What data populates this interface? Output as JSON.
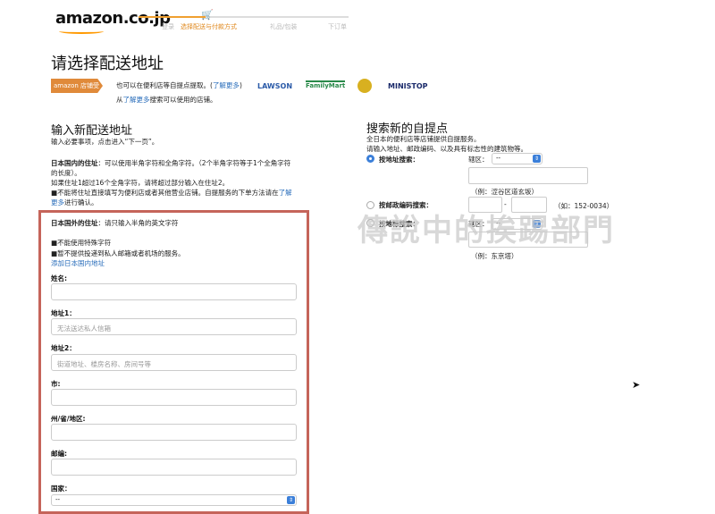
{
  "header": {
    "logo": "amazon.co.jp",
    "steps": [
      "登录",
      "选择配送与付款方式",
      "礼品/包装",
      "下订单"
    ],
    "active_step": 1
  },
  "page_title": "请选择配送地址",
  "pickup_banner": {
    "badge": "amazon 店铺受取",
    "line1": "也可以在便利店等自提点提取。(",
    "line1_link": "了解更多",
    "line1_end": ")",
    "line2_pre": "从",
    "line2_link": "了解更多",
    "line2_post": "搜索可以使用的店铺。",
    "stores": [
      "LAWSON",
      "FamilyMart",
      "ヤマト運輸",
      "MINISTOP"
    ]
  },
  "new_address": {
    "title": "输入新配送地址",
    "subtitle": "输入必要事项，点击进入“下一页”。",
    "domestic_label": "日本国内的住址",
    "domestic_text": "：可以使用半角字符和全角字符。（2个半角字符等于1个全角字符的长度）。",
    "domestic_note1": "如果住址1超过16个全角字符，请将超过部分输入在住址2。",
    "domestic_note2": "■不能将住址直接填写为便利店或者其他营业店铺。自提服务的下单方法请在",
    "domestic_note2_link": "了解更多",
    "domestic_note2_end": "进行确认。",
    "foreign_label": "日本国外的住址",
    "foreign_text": "：请只输入半角的英文字符",
    "foreign_note1": "■不能使用特殊字符",
    "foreign_note2": "■暂不提供投递到私人邮箱或者机场的服务。",
    "add_domestic_link": "添加日本国内地址",
    "fields": [
      {
        "label": "姓名:",
        "placeholder": ""
      },
      {
        "label": "地址1：",
        "placeholder": "无法送达私人信箱"
      },
      {
        "label": "地址2：",
        "placeholder": "街道地址、楼房名称、房间号等"
      },
      {
        "label": "市:",
        "placeholder": ""
      },
      {
        "label": "州/省/地区:",
        "placeholder": ""
      },
      {
        "label": "邮编:",
        "placeholder": ""
      }
    ],
    "country_label": "国家：",
    "country_value": "--"
  },
  "pickup_search": {
    "title": "搜索新的自提点",
    "line1": "全日本的便利店等店铺提供自提服务。",
    "line2": "请输入地址、邮政编码、以及具有标志性的建筑物等。",
    "by_address": "按地址搜索：",
    "district_label": "辖区：",
    "district_value": "--",
    "address_example": "（例：涩谷区道玄坂）",
    "by_postal": "按邮政编码搜索：",
    "postal_sep": "-",
    "postal_example": "（如：152-0034）",
    "by_landmark": "按地标搜索：",
    "landmark_district_label": "辖区：",
    "landmark_district_value": "--",
    "landmark_example": "（例：东京塔）"
  },
  "watermark": "傳說中的挨踢部門",
  "colors": {
    "accent": "#e08a20",
    "link": "#2a6ebb",
    "highlight_box": "#c5645a"
  }
}
